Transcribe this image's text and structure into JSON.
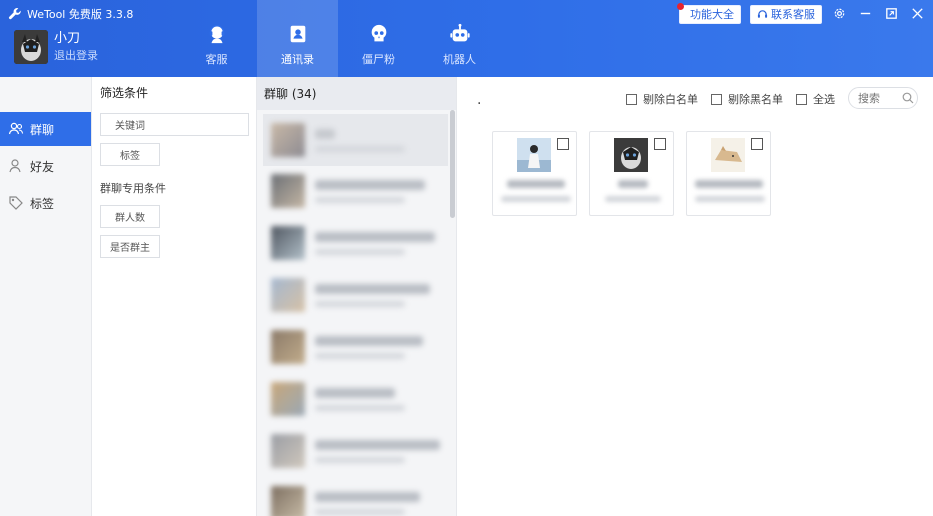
{
  "app": {
    "title": "WeTool 免费版 3.3.8"
  },
  "user": {
    "name": "小刀",
    "logout": "退出登录"
  },
  "nav": {
    "tabs": [
      {
        "label": "客服",
        "icon": "headset-icon"
      },
      {
        "label": "通讯录",
        "icon": "contacts-icon",
        "active": true
      },
      {
        "label": "僵尸粉",
        "icon": "skull-icon"
      },
      {
        "label": "机器人",
        "icon": "robot-icon"
      }
    ]
  },
  "header": {
    "features": "功能大全",
    "support": "联系客服",
    "window": [
      "gear-icon",
      "minimize-icon",
      "maximize-icon",
      "close-icon"
    ]
  },
  "sidebar": {
    "items": [
      {
        "label": "群聊",
        "icon": "group-icon",
        "active": true
      },
      {
        "label": "好友",
        "icon": "friend-icon"
      },
      {
        "label": "标签",
        "icon": "tag-icon"
      }
    ]
  },
  "filter": {
    "title": "筛选条件",
    "keyword_label": "关键词",
    "keyword_value": "",
    "tag": "标签",
    "group_section": "群聊专用条件",
    "member_count": "群人数",
    "is_owner": "是否群主"
  },
  "groups": {
    "header_label": "群聊",
    "count": "(34)"
  },
  "main": {
    "dot": ".",
    "remove_whitelist": "剔除白名单",
    "remove_blacklist": "剔除黑名单",
    "select_all": "全选",
    "search_placeholder": "搜索"
  },
  "colors": {
    "primary": "#2f6ee8",
    "header_start": "#2a63dc",
    "red_dot": "#e6232e"
  }
}
